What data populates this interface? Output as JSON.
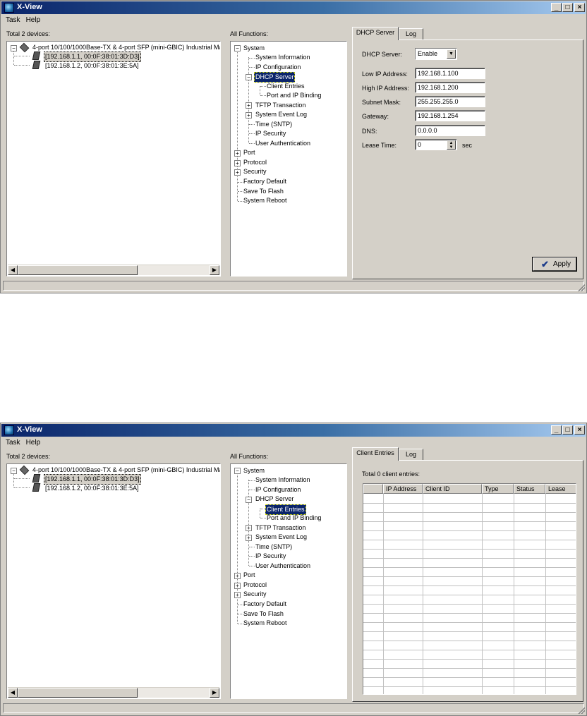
{
  "app": {
    "title": "X-View"
  },
  "window_controls": {
    "minimize": "_",
    "maximize": "□",
    "close": "×"
  },
  "menu": {
    "task": "Task",
    "help": "Help"
  },
  "devices": {
    "header": "Total 2 devices:",
    "root": "4-port 10/100/1000Base-TX & 4-port SFP (mini-GBIC) Industrial Má",
    "items": [
      "[192.168.1.1, 00:0F:38:01:3D:D3]",
      "[192.168.1.2, 00:0F:38:01:3E:5A]"
    ]
  },
  "functions": {
    "header": "All Functions:",
    "tree": [
      "System",
      "System Information",
      "IP Configuration",
      "DHCP Server",
      "Client Entries",
      "Port and IP Binding",
      "TFTP Transaction",
      "System Event Log",
      "Time (SNTP)",
      "IP Security",
      "User Authentication",
      "Port",
      "Protocol",
      "Security",
      "Factory Default",
      "Save To Flash",
      "System Reboot"
    ]
  },
  "dhcp_view": {
    "tabs": [
      "DHCP Server",
      "Log"
    ],
    "fields": {
      "dhcp_server_label": "DHCP Server:",
      "dhcp_server_value": "Enable",
      "low_ip_label": "Low IP Address:",
      "low_ip_value": "192.168.1.100",
      "high_ip_label": "High IP Address:",
      "high_ip_value": "192.168.1.200",
      "subnet_label": "Subnet Mask:",
      "subnet_value": "255.255.255.0",
      "gateway_label": "Gateway:",
      "gateway_value": "192.168.1.254",
      "dns_label": "DNS:",
      "dns_value": "0.0.0.0",
      "lease_label": "Lease Time:",
      "lease_value": "0",
      "lease_unit": "sec"
    },
    "apply_label": "Apply"
  },
  "client_view": {
    "tabs": [
      "Client Entries",
      "Log"
    ],
    "total": "Total 0 client entries:",
    "columns": [
      "",
      "IP Address",
      "Client ID",
      "Type",
      "Status",
      "Lease"
    ]
  }
}
